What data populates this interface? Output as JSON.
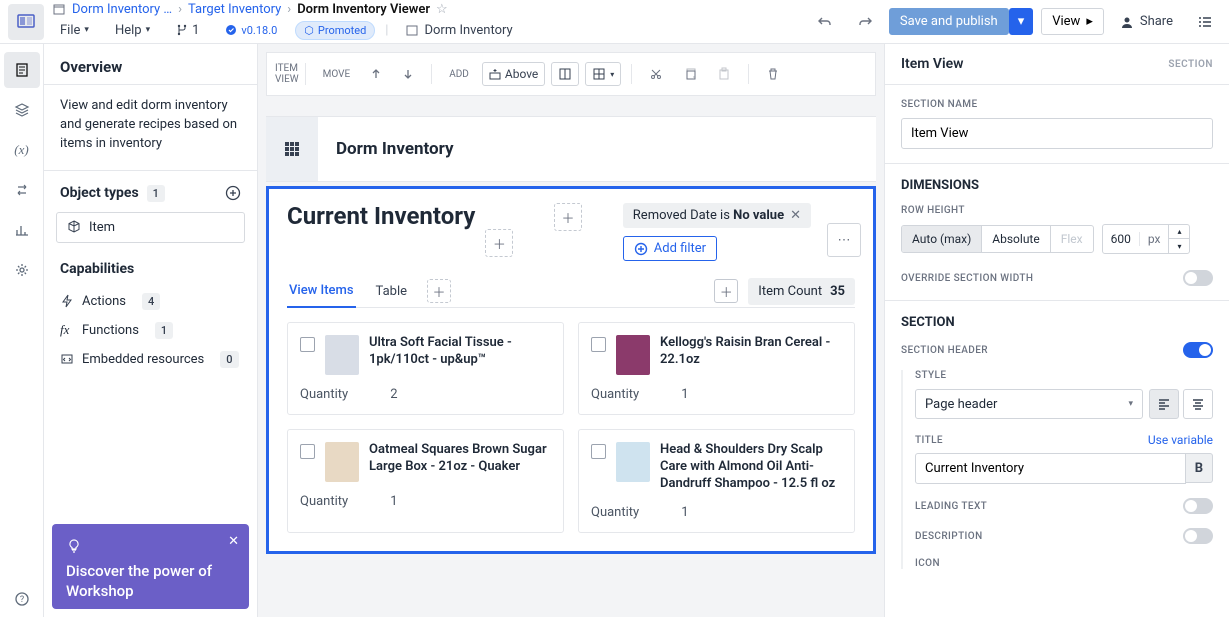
{
  "breadcrumb": {
    "root": "Dorm Inventory …",
    "mid": "Target Inventory",
    "current": "Dorm Inventory Viewer"
  },
  "menubar": {
    "file": "File",
    "help": "Help",
    "branch_count": "1",
    "version": "v0.18.0",
    "promoted": "Promoted",
    "crumb_app": "Dorm Inventory"
  },
  "top_actions": {
    "save": "Save and publish",
    "view": "View",
    "share": "Share"
  },
  "sidebar": {
    "title": "Overview",
    "desc": "View and edit dorm inventory and generate recipes based on items in inventory",
    "object_types": {
      "label": "Object types",
      "count": "1",
      "item": "Item"
    },
    "capabilities": {
      "label": "Capabilities",
      "actions": {
        "label": "Actions",
        "count": "4"
      },
      "functions": {
        "label": "Functions",
        "count": "1"
      },
      "embedded": {
        "label": "Embedded resources",
        "count": "0"
      }
    }
  },
  "promo": {
    "title": "Discover the power of Workshop"
  },
  "canvas_toolbar": {
    "section": "ITEM\nVIEW",
    "move": "MOVE",
    "add": "ADD",
    "above": "Above"
  },
  "widget": {
    "header": "Dorm Inventory",
    "card_title": "Current Inventory",
    "filter_chip_pre": "Removed Date is ",
    "filter_chip_val": "No value",
    "add_filter": "Add filter",
    "tabs": {
      "view_items": "View Items",
      "table": "Table"
    },
    "count_label": "Item Count",
    "count_value": "35",
    "items": [
      {
        "name": "Ultra Soft Facial Tissue - 1pk/110ct - up&up™",
        "qty_label": "Quantity",
        "qty": "2"
      },
      {
        "name": "Kellogg's Raisin Bran Cereal - 22.1oz",
        "qty_label": "Quantity",
        "qty": "1"
      },
      {
        "name": "Oatmeal Squares Brown Sugar Large Box - 21oz - Quaker",
        "qty_label": "Quantity",
        "qty": "1"
      },
      {
        "name": "Head & Shoulders Dry Scalp Care with Almond Oil Anti-Dandruff Shampoo - 12.5 fl oz",
        "qty_label": "Quantity",
        "qty": "1"
      }
    ]
  },
  "right": {
    "title": "Item View",
    "tag": "SECTION",
    "section_name_label": "SECTION NAME",
    "section_name_value": "Item View",
    "dimensions": "DIMENSIONS",
    "row_height": "ROW HEIGHT",
    "seg": {
      "auto": "Auto (max)",
      "abs": "Absolute",
      "flex": "Flex"
    },
    "height_val": "600",
    "height_unit": "px",
    "override": "OVERRIDE SECTION WIDTH",
    "section": "SECTION",
    "section_header": "SECTION HEADER",
    "style": "STYLE",
    "style_val": "Page header",
    "title_label": "TITLE",
    "use_var": "Use variable",
    "title_val": "Current Inventory",
    "leading": "LEADING TEXT",
    "desc": "DESCRIPTION",
    "icon": "ICON"
  }
}
